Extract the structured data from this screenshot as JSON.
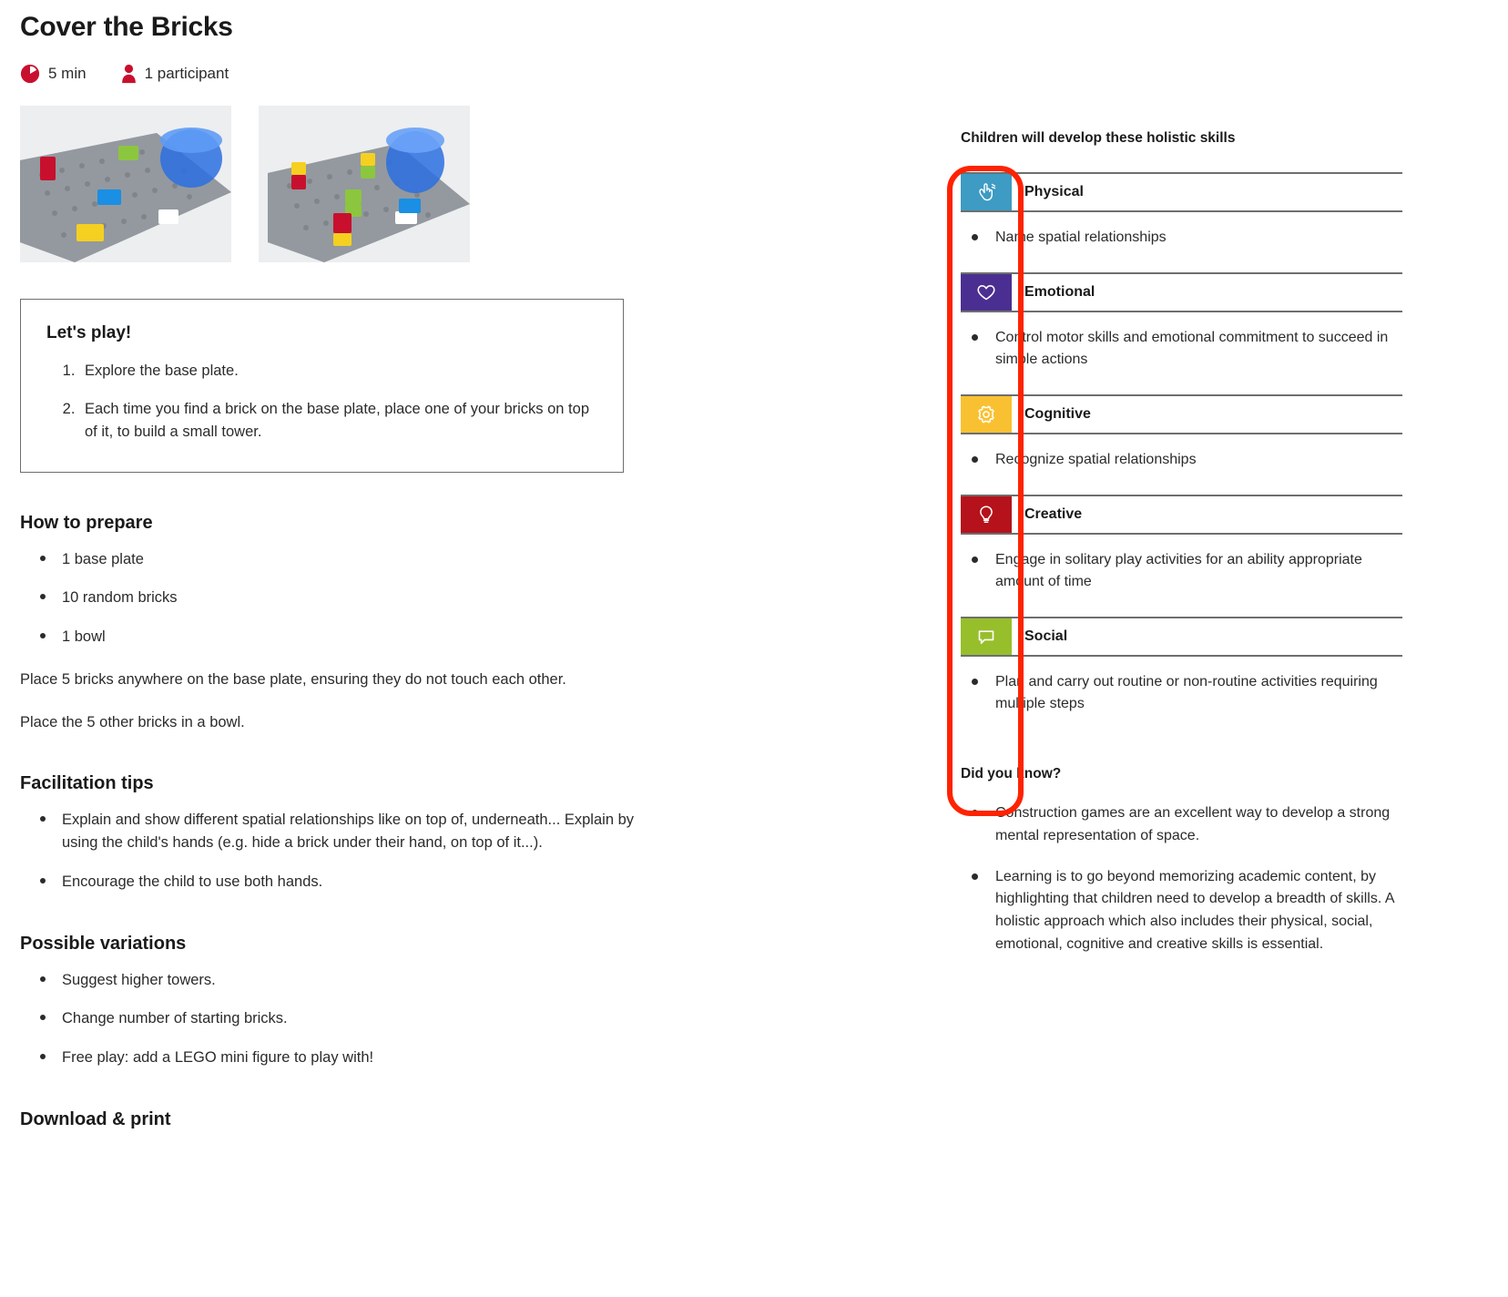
{
  "header": {
    "title": "Cover the Bricks",
    "duration": "5 min",
    "participants": "1 participant",
    "clock_icon": "clock-icon",
    "person_icon": "person-icon"
  },
  "photos": [
    {
      "alt": "Lego base plate with scattered bricks and blue bowl"
    },
    {
      "alt": "Lego base plate with stacked brick towers and blue bowl"
    }
  ],
  "play_box": {
    "title": "Let's play!",
    "steps": [
      "Explore the base plate.",
      "Each time you find a brick on the base plate, place one of your bricks on top of it, to build a small tower."
    ]
  },
  "prepare": {
    "title": "How to prepare",
    "items": [
      "1 base plate",
      "10 random bricks",
      "1 bowl"
    ],
    "paragraphs": [
      "Place 5 bricks anywhere on the base plate, ensuring they do not touch each other.",
      "Place the 5 other bricks in a bowl."
    ]
  },
  "facilitation": {
    "title": "Facilitation tips",
    "items": [
      "Explain and show different spatial relationships like on top of, underneath... Explain by using the child's hands (e.g. hide a brick under their hand, on top of it...).",
      "Encourage the child to use both hands."
    ]
  },
  "variations": {
    "title": "Possible variations",
    "items": [
      "Suggest higher towers.",
      "Change number of starting bricks.",
      "Free play: add a LEGO mini figure to play with!"
    ]
  },
  "download": {
    "title": "Download & print"
  },
  "skills": {
    "heading": "Children will develop these holistic skills",
    "items": [
      {
        "name": "Physical",
        "icon": "hand-icon",
        "color": "#3d9bc4",
        "points": [
          "Name spatial relationships"
        ]
      },
      {
        "name": "Emotional",
        "icon": "heart-icon",
        "color": "#4b2e91",
        "points": [
          "Control motor skills and emotional commitment to succeed in simple actions"
        ]
      },
      {
        "name": "Cognitive",
        "icon": "gear-icon",
        "color": "#f9c132",
        "points": [
          "Recognize spatial relationships"
        ]
      },
      {
        "name": "Creative",
        "icon": "lightbulb-icon",
        "color": "#b5121b",
        "points": [
          "Engage in solitary play activities for an ability appropriate amount of time"
        ]
      },
      {
        "name": "Social",
        "icon": "speech-bubble-icon",
        "color": "#97bf2b",
        "points": [
          "Plan and carry out routine or non-routine activities requiring multiple steps"
        ]
      }
    ]
  },
  "did_you_know": {
    "heading": "Did you know?",
    "items": [
      "Construction games are an excellent way to develop a strong mental representation of space.",
      "Learning is to go beyond memorizing academic content, by highlighting that children need to develop a breadth of skills. A holistic approach which also includes their physical, social, emotional, cognitive and creative skills is essential."
    ]
  },
  "annotation": {
    "color": "#ff2200"
  }
}
